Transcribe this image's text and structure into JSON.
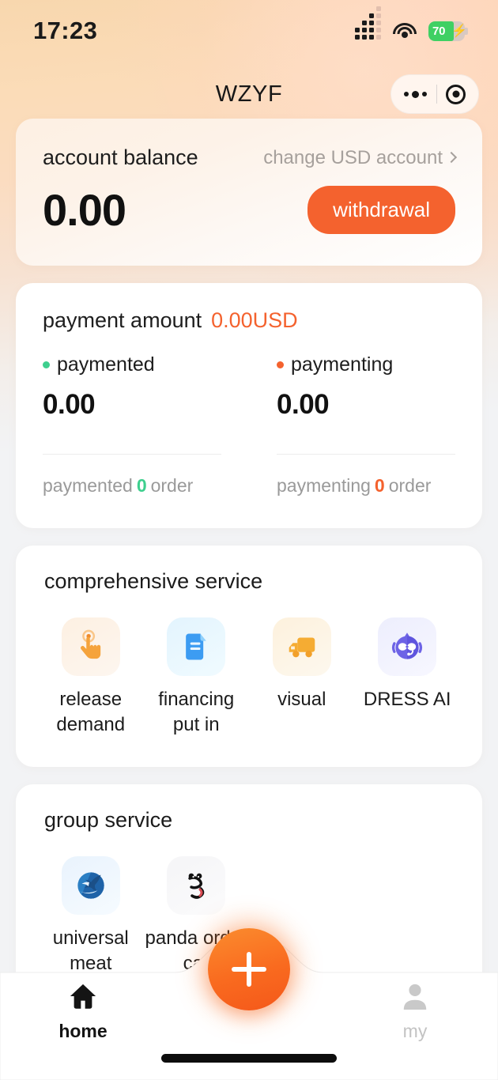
{
  "status_bar": {
    "time": "17:23",
    "battery_level": "70",
    "battery_charging": true,
    "signal_icon": "signal-bars-icon",
    "wifi_icon": "wifi-icon"
  },
  "nav": {
    "title": "WZYF",
    "capsule": {
      "menu_icon": "more-dots-icon",
      "target_icon": "target-circle-icon"
    }
  },
  "balance_card": {
    "label": "account balance",
    "change_account": "change USD account",
    "amount": "0.00",
    "withdraw_label": "withdrawal"
  },
  "payment_card": {
    "title": "payment amount",
    "total": "0.00USD",
    "columns": [
      {
        "legend": "paymented",
        "dot_color": "#3ecf8e",
        "value": "0.00",
        "footer_prefix": "paymented",
        "footer_count": "0",
        "footer_suffix": "order",
        "count_color": "#3ecf8e"
      },
      {
        "legend": "paymenting",
        "dot_color": "#f4622e",
        "value": "0.00",
        "footer_prefix": "paymenting",
        "footer_count": "0",
        "footer_suffix": "order",
        "count_color": "#f4622e"
      }
    ]
  },
  "comprehensive_service": {
    "title": "comprehensive service",
    "items": [
      {
        "label": "release demand",
        "icon": "tap-hand-icon"
      },
      {
        "label": "financing put in",
        "icon": "document-lines-icon"
      },
      {
        "label": "visual",
        "icon": "delivery-truck-icon"
      },
      {
        "label": "DRESS AI",
        "icon": "ai-robot-head-icon"
      }
    ]
  },
  "group_service": {
    "title": "group service",
    "items": [
      {
        "label": "universal meat",
        "icon": "eagle-logo-icon"
      },
      {
        "label": "panda order car",
        "icon": "panda-logo-icon"
      }
    ]
  },
  "tabbar": {
    "tabs": [
      {
        "label": "home",
        "icon": "home-icon",
        "active": true
      },
      {
        "label": "my",
        "icon": "person-icon",
        "active": false
      }
    ],
    "fab": {
      "icon": "plus-icon",
      "label": "+"
    }
  },
  "colors": {
    "accent": "#f4622e",
    "fab": "#f97a28",
    "success": "#3ecf8e",
    "battery": "#3fd063"
  }
}
